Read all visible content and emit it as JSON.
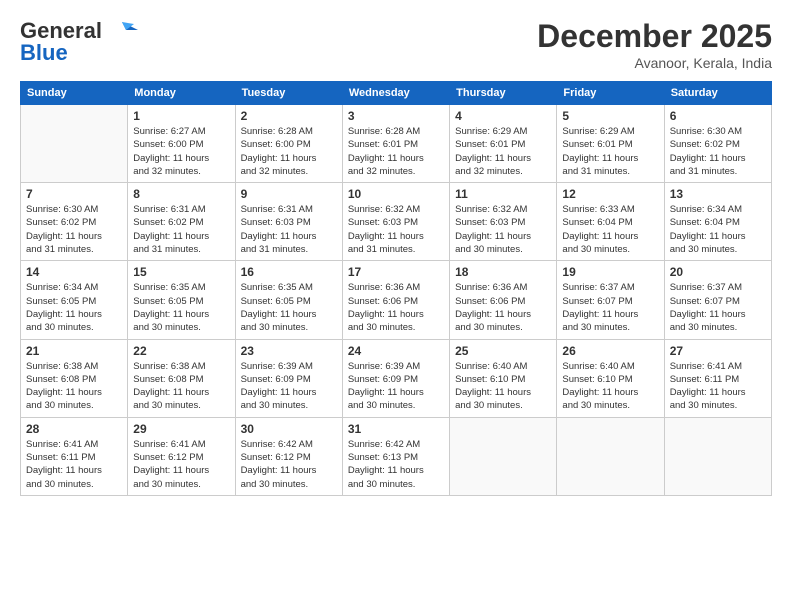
{
  "header": {
    "logo_general": "General",
    "logo_blue": "Blue",
    "month": "December 2025",
    "location": "Avanoor, Kerala, India"
  },
  "days_header": [
    "Sunday",
    "Monday",
    "Tuesday",
    "Wednesday",
    "Thursday",
    "Friday",
    "Saturday"
  ],
  "weeks": [
    [
      {
        "day": "",
        "info": ""
      },
      {
        "day": "1",
        "info": "Sunrise: 6:27 AM\nSunset: 6:00 PM\nDaylight: 11 hours\nand 32 minutes."
      },
      {
        "day": "2",
        "info": "Sunrise: 6:28 AM\nSunset: 6:00 PM\nDaylight: 11 hours\nand 32 minutes."
      },
      {
        "day": "3",
        "info": "Sunrise: 6:28 AM\nSunset: 6:01 PM\nDaylight: 11 hours\nand 32 minutes."
      },
      {
        "day": "4",
        "info": "Sunrise: 6:29 AM\nSunset: 6:01 PM\nDaylight: 11 hours\nand 32 minutes."
      },
      {
        "day": "5",
        "info": "Sunrise: 6:29 AM\nSunset: 6:01 PM\nDaylight: 11 hours\nand 31 minutes."
      },
      {
        "day": "6",
        "info": "Sunrise: 6:30 AM\nSunset: 6:02 PM\nDaylight: 11 hours\nand 31 minutes."
      }
    ],
    [
      {
        "day": "7",
        "info": "Sunrise: 6:30 AM\nSunset: 6:02 PM\nDaylight: 11 hours\nand 31 minutes."
      },
      {
        "day": "8",
        "info": "Sunrise: 6:31 AM\nSunset: 6:02 PM\nDaylight: 11 hours\nand 31 minutes."
      },
      {
        "day": "9",
        "info": "Sunrise: 6:31 AM\nSunset: 6:03 PM\nDaylight: 11 hours\nand 31 minutes."
      },
      {
        "day": "10",
        "info": "Sunrise: 6:32 AM\nSunset: 6:03 PM\nDaylight: 11 hours\nand 31 minutes."
      },
      {
        "day": "11",
        "info": "Sunrise: 6:32 AM\nSunset: 6:03 PM\nDaylight: 11 hours\nand 30 minutes."
      },
      {
        "day": "12",
        "info": "Sunrise: 6:33 AM\nSunset: 6:04 PM\nDaylight: 11 hours\nand 30 minutes."
      },
      {
        "day": "13",
        "info": "Sunrise: 6:34 AM\nSunset: 6:04 PM\nDaylight: 11 hours\nand 30 minutes."
      }
    ],
    [
      {
        "day": "14",
        "info": "Sunrise: 6:34 AM\nSunset: 6:05 PM\nDaylight: 11 hours\nand 30 minutes."
      },
      {
        "day": "15",
        "info": "Sunrise: 6:35 AM\nSunset: 6:05 PM\nDaylight: 11 hours\nand 30 minutes."
      },
      {
        "day": "16",
        "info": "Sunrise: 6:35 AM\nSunset: 6:05 PM\nDaylight: 11 hours\nand 30 minutes."
      },
      {
        "day": "17",
        "info": "Sunrise: 6:36 AM\nSunset: 6:06 PM\nDaylight: 11 hours\nand 30 minutes."
      },
      {
        "day": "18",
        "info": "Sunrise: 6:36 AM\nSunset: 6:06 PM\nDaylight: 11 hours\nand 30 minutes."
      },
      {
        "day": "19",
        "info": "Sunrise: 6:37 AM\nSunset: 6:07 PM\nDaylight: 11 hours\nand 30 minutes."
      },
      {
        "day": "20",
        "info": "Sunrise: 6:37 AM\nSunset: 6:07 PM\nDaylight: 11 hours\nand 30 minutes."
      }
    ],
    [
      {
        "day": "21",
        "info": "Sunrise: 6:38 AM\nSunset: 6:08 PM\nDaylight: 11 hours\nand 30 minutes."
      },
      {
        "day": "22",
        "info": "Sunrise: 6:38 AM\nSunset: 6:08 PM\nDaylight: 11 hours\nand 30 minutes."
      },
      {
        "day": "23",
        "info": "Sunrise: 6:39 AM\nSunset: 6:09 PM\nDaylight: 11 hours\nand 30 minutes."
      },
      {
        "day": "24",
        "info": "Sunrise: 6:39 AM\nSunset: 6:09 PM\nDaylight: 11 hours\nand 30 minutes."
      },
      {
        "day": "25",
        "info": "Sunrise: 6:40 AM\nSunset: 6:10 PM\nDaylight: 11 hours\nand 30 minutes."
      },
      {
        "day": "26",
        "info": "Sunrise: 6:40 AM\nSunset: 6:10 PM\nDaylight: 11 hours\nand 30 minutes."
      },
      {
        "day": "27",
        "info": "Sunrise: 6:41 AM\nSunset: 6:11 PM\nDaylight: 11 hours\nand 30 minutes."
      }
    ],
    [
      {
        "day": "28",
        "info": "Sunrise: 6:41 AM\nSunset: 6:11 PM\nDaylight: 11 hours\nand 30 minutes."
      },
      {
        "day": "29",
        "info": "Sunrise: 6:41 AM\nSunset: 6:12 PM\nDaylight: 11 hours\nand 30 minutes."
      },
      {
        "day": "30",
        "info": "Sunrise: 6:42 AM\nSunset: 6:12 PM\nDaylight: 11 hours\nand 30 minutes."
      },
      {
        "day": "31",
        "info": "Sunrise: 6:42 AM\nSunset: 6:13 PM\nDaylight: 11 hours\nand 30 minutes."
      },
      {
        "day": "",
        "info": ""
      },
      {
        "day": "",
        "info": ""
      },
      {
        "day": "",
        "info": ""
      }
    ]
  ]
}
